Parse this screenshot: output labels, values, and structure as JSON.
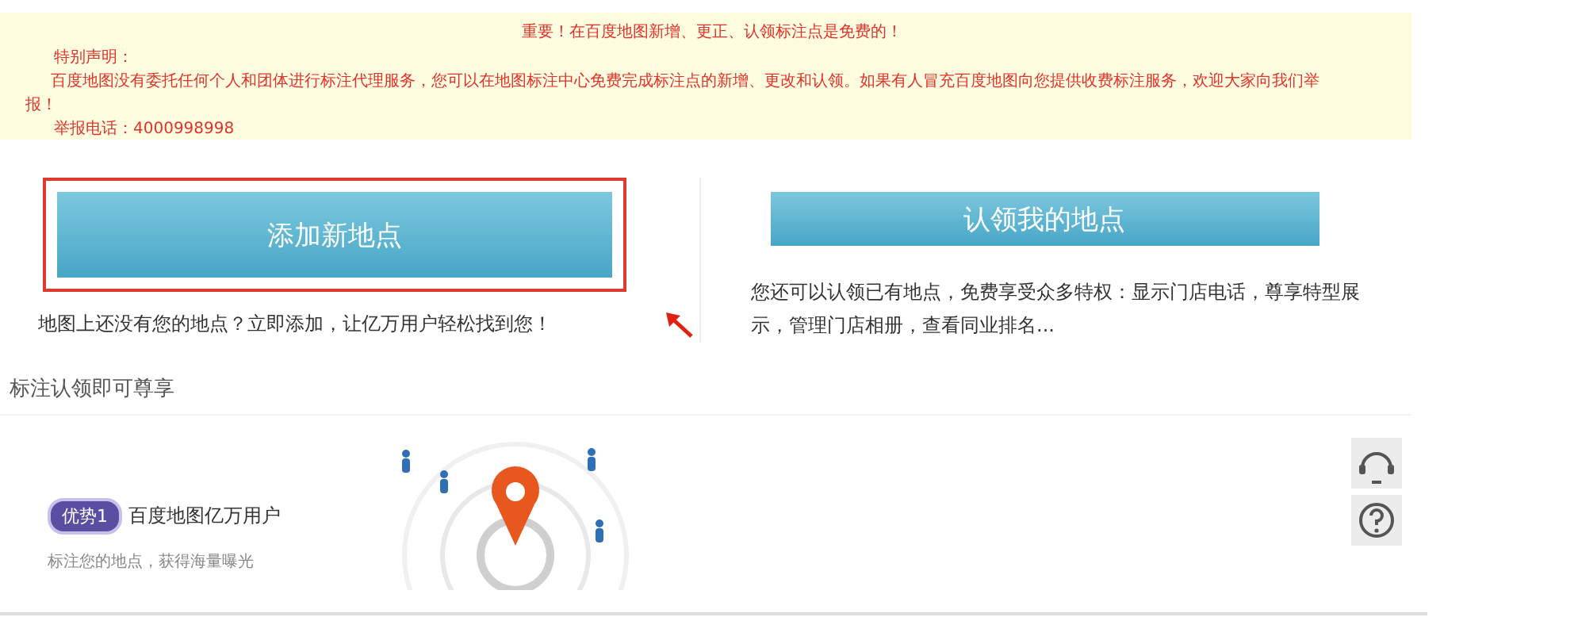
{
  "notice": {
    "headline": "重要！在百度地图新增、更正、认领标注点是免费的！",
    "declaration_title": "特别声明：",
    "declaration_body": "百度地图没有委托任何个人和团体进行标注代理服务，您可以在地图标注中心免费完成标注点的新增、更改和认领。如果有人冒充百度地图向您提供收费标注服务，欢迎大家向我们举报！",
    "hotline": "举报电话：4000998998"
  },
  "actions": [
    {
      "label": "添加新地点",
      "selected": true,
      "description": "地图上还没有您的地点？立即添加，让亿万用户轻松找到您！"
    },
    {
      "label": "认领我的地点",
      "selected": false,
      "description": "您还可以认领已有地点，免费享受众多特权：显示门店电话，尊享特型展示，管理门店相册，查看同业排名..."
    }
  ],
  "benefits": {
    "heading": "标注认领即可尊享",
    "items": [
      {
        "badge": "优势1",
        "title": "百度地图亿万用户",
        "text": "标注您的地点，获得海量曝光"
      }
    ]
  }
}
